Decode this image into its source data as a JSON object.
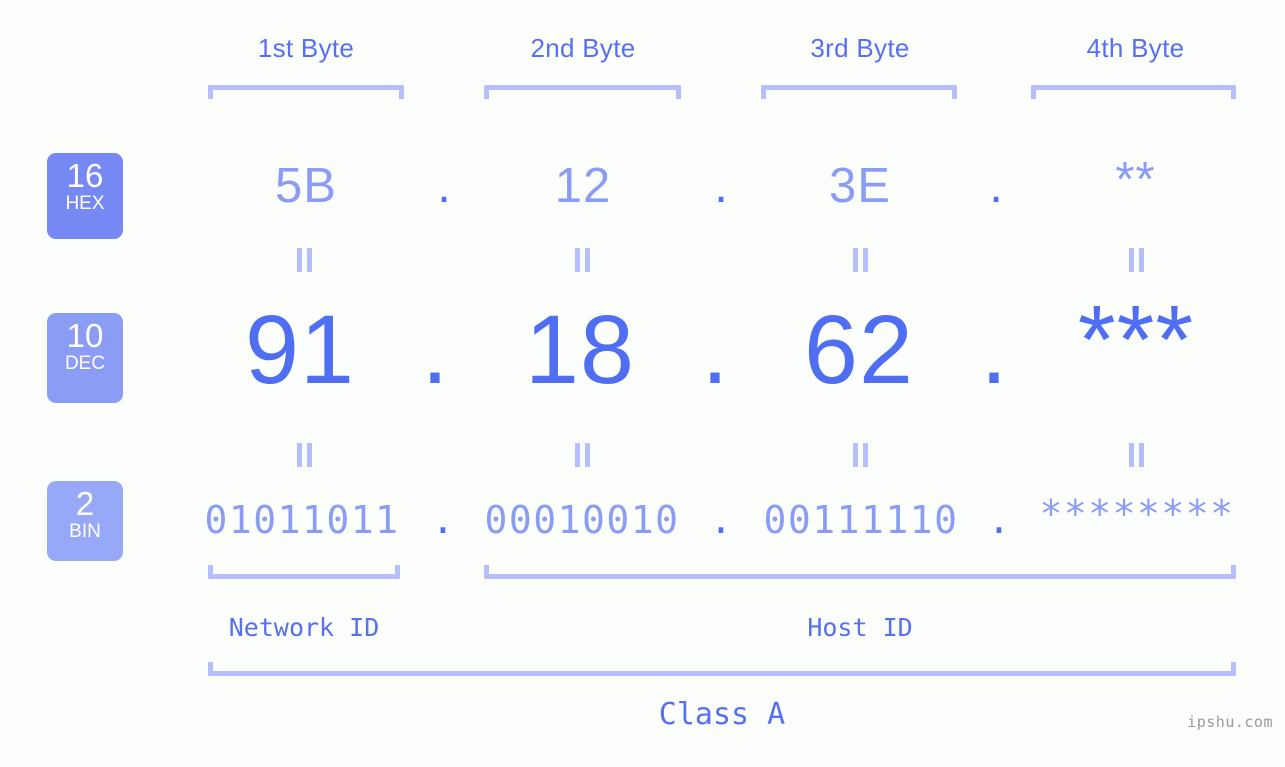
{
  "page": {
    "background_color": "#fcfefb",
    "accent_color": "#4f6ef2",
    "accent_light_color": "#8b9cf5",
    "bracket_color": "#b6bffb",
    "watermark": "ipshu.com"
  },
  "byte_headers": [
    {
      "label": "1st Byte"
    },
    {
      "label": "2nd Byte"
    },
    {
      "label": "3rd Byte"
    },
    {
      "label": "4th Byte"
    }
  ],
  "bases": [
    {
      "number": "16",
      "abbr": "HEX",
      "color": "#7588f4"
    },
    {
      "number": "10",
      "abbr": "DEC",
      "color": "#8b9cf5"
    },
    {
      "number": "2",
      "abbr": "BIN",
      "color": "#96a8f7"
    }
  ],
  "rows": {
    "hex": {
      "values": [
        "5B",
        "12",
        "3E",
        "**"
      ],
      "separator": "."
    },
    "dec": {
      "values": [
        "91",
        "18",
        "62",
        "***"
      ],
      "separator": "."
    },
    "bin": {
      "values": [
        "01011011",
        "00010010",
        "00111110",
        "********"
      ],
      "separator": "."
    }
  },
  "equals_marks": {
    "glyph": "||",
    "count_per_row": 4
  },
  "id_labels": {
    "network": "Network ID",
    "host": "Host ID"
  },
  "class_label": "Class A"
}
